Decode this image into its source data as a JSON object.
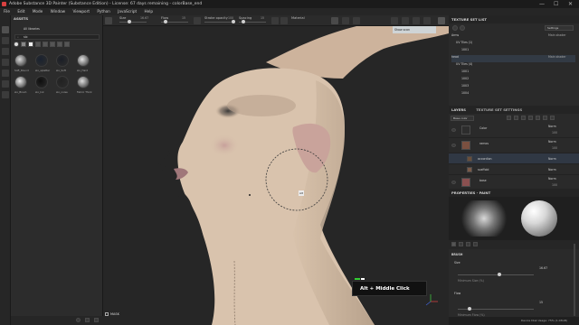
{
  "window": {
    "title": "Adobe Substance 3D Painter (Substance Edition) - License: 67 days remaining - colorBase_end",
    "controls": [
      "—",
      "☐",
      "✕"
    ]
  },
  "menu": [
    "File",
    "Edit",
    "Mode",
    "Window",
    "Viewport",
    "Python",
    "JavaScript",
    "Help"
  ],
  "toolbar": {
    "size_label": "Size",
    "size_value": "16.67",
    "flow_label": "Flow",
    "flow_value": "15",
    "stroke_opacity_label": "Stroke opacity",
    "stroke_opacity_value": "100",
    "spacing_label": "Spacing",
    "spacing_value": "15",
    "material_label": "Material",
    "size_level": 0.35,
    "flow_level": 0.15,
    "opacity_level": 1.0,
    "spacing_level": 0.15
  },
  "assets": {
    "title": "ASSETS",
    "library": "All libraries",
    "search_value": "slo",
    "items": [
      {
        "label": "Soft_Round",
        "color": "#d8d8d8"
      },
      {
        "label": "slo_splatter",
        "color": "#1a2230"
      },
      {
        "label": "slo_Soft",
        "color": "#1b1e26"
      },
      {
        "label": "slo_Hard",
        "color": "#e4e4e4"
      },
      {
        "label": "slo_Brush",
        "color": "#eaeaea"
      },
      {
        "label": "slo_Ink",
        "color": "#0e0e0e"
      },
      {
        "label": "slo_noise",
        "color": "#222"
      },
      {
        "label": "Fabric Thick",
        "color": "#dedede"
      }
    ]
  },
  "viewport": {
    "cursor_readout": "Alt",
    "shortcut_overlay": "Alt + Middle Click",
    "tooltip": "Show scan",
    "mask_label": "MASK"
  },
  "texture_set_list": {
    "title": "TEXTURE SET LIST",
    "shader": "Settings",
    "items": [
      {
        "name": "Arms",
        "shader": "Main shader"
      },
      {
        "name": "UV Tiles (1)",
        "shader": ""
      },
      {
        "name": "1001",
        "shader": ""
      },
      {
        "name": "head",
        "shader": "Main shader"
      },
      {
        "name": "UV Tiles (4)",
        "shader": ""
      },
      {
        "name": "1001",
        "shader": ""
      },
      {
        "name": "1002",
        "shader": ""
      },
      {
        "name": "1003",
        "shader": ""
      },
      {
        "name": "1004",
        "shader": ""
      }
    ]
  },
  "layers": {
    "tab_layers": "LAYERS",
    "tab_settings": "TEXTURE SET SETTINGS",
    "channel": "Base color",
    "rows": [
      {
        "name": "Color",
        "blend": "Norm",
        "opacity": "100"
      },
      {
        "name": "ramos",
        "blend": "Norm",
        "opacity": "100"
      },
      {
        "name": "accordion",
        "blend": "Norm",
        "opacity": "100"
      },
      {
        "name": "scaffold",
        "blend": "Norm",
        "opacity": "100"
      },
      {
        "name": "base",
        "blend": "Norm",
        "opacity": "100"
      }
    ]
  },
  "properties": {
    "title": "PROPERTIES - PAINT",
    "brush_header": "BRUSH",
    "size_label": "Size",
    "size_value": "16.67",
    "size_level": 0.55,
    "min_size_label": "Minimum Size (%)",
    "flow_label": "Flow",
    "flow_value": "15",
    "flow_level": 0.15,
    "min_flow_label": "Minimum Flow (%)"
  },
  "statusbar": {
    "cache": "Device Disk Usage: 75% (1.03GB)"
  },
  "colors": {
    "skin": "#d9c3ad",
    "skin_shadow": "#bca690",
    "horn": "#c4ab95",
    "cheek": "#c9a09a",
    "accent_orange": "#e07b20",
    "accent_green": "#33cc33"
  }
}
